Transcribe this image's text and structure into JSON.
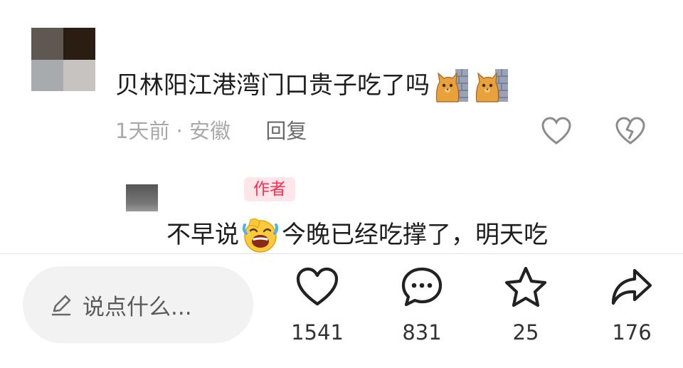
{
  "comment": {
    "text": "贝林阳江港湾门口贵子吃了吗",
    "emoji_icons": [
      "cat-at-wall-emoji",
      "cat-at-wall-emoji"
    ],
    "time": "1天前",
    "separator": "·",
    "location": "安徽",
    "reply_label": "回复"
  },
  "reply": {
    "badge": "作者",
    "text_before": "不早说",
    "emoji_icon": "laughing-crying-emoji",
    "text_after": "今晚已经吃撑了，明天吃"
  },
  "bottom_bar": {
    "input_placeholder": "说点什么...",
    "likes": "1541",
    "comments": "831",
    "favorites": "25",
    "shares": "176"
  },
  "colors": {
    "accent": "#ff2c4f",
    "badge_bg": "#ffe6ea",
    "meta_text": "#a9a9a9",
    "input_bg": "#f2f2f2"
  }
}
